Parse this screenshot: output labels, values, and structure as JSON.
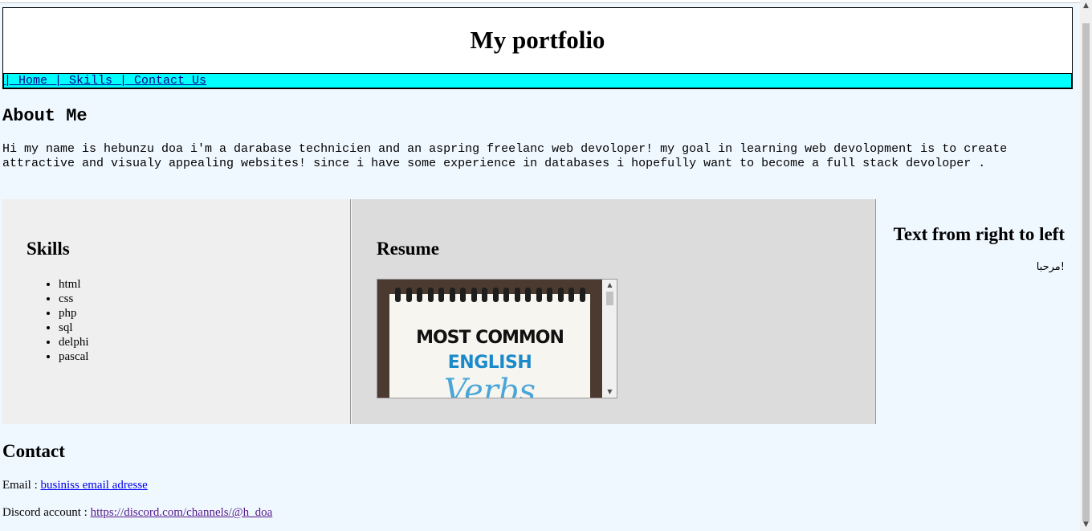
{
  "header": {
    "title": "My portfolio",
    "nav": [
      {
        "label": "| Home "
      },
      {
        "label": "| Skills "
      },
      {
        "label": "| Contact Us"
      }
    ]
  },
  "about": {
    "heading": "About Me",
    "text": "Hi my name is hebunzu doa i'm a darabase technicien and an aspring freelanc web devoloper! my goal in learning web devolopment is to create attractive and visualy appealing websites! since i have some experience in databases i hopefully want to become a full stack devoloper ."
  },
  "skills": {
    "heading": "Skills",
    "items": [
      "html",
      "css",
      "php",
      "sql",
      "delphi",
      "pascal"
    ]
  },
  "resume": {
    "heading": "Resume",
    "image_text": [
      "MOST COMMON",
      "ENGLISH",
      "Verbs"
    ]
  },
  "rtl": {
    "heading": "Text from right to left",
    "text": "!مرحبا"
  },
  "contact": {
    "heading": "Contact",
    "email_label": "Email : ",
    "email_link": "businiss email adresse",
    "discord_label": "Discord account : ",
    "discord_link": "https://discord.com/channels/@h_doa"
  },
  "colors": {
    "page_background": "#f0f8ff",
    "nav_background": "#00ffff",
    "skills_background": "#efefef",
    "resume_background": "#dcdcdc",
    "link": "#0000ee",
    "visited_link": "#551a8b"
  }
}
